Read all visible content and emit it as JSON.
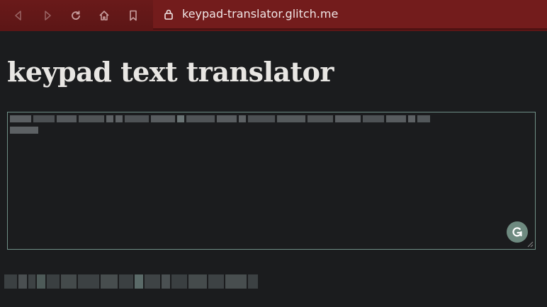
{
  "browser": {
    "url": "keypad-translator.glitch.me",
    "icons": [
      "back-icon",
      "forward-icon",
      "reload-icon",
      "home-icon",
      "bookmark-icon",
      "lock-icon"
    ]
  },
  "page": {
    "title": "keypad text translator"
  },
  "textarea": {
    "value": "[pixelated text]",
    "grammarly_icon": "grammarly-icon"
  },
  "output": {
    "text": "[pixelated text]"
  },
  "colors": {
    "toolbar": "#6a1a1a",
    "background": "#1b1c1e",
    "title": "#e8e6e3",
    "textarea_border": "#6f8f86",
    "grammarly": "#6e8a80"
  }
}
